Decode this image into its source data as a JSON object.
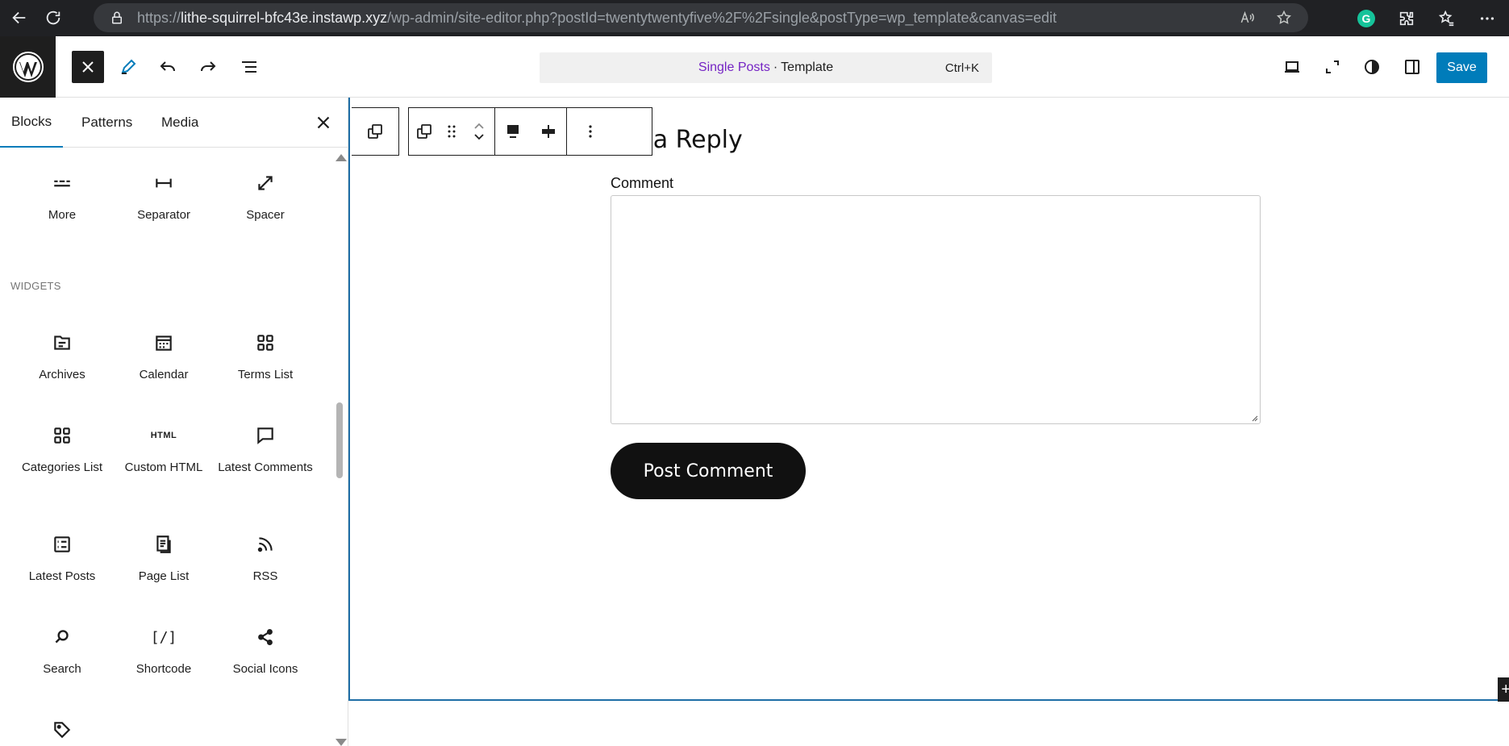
{
  "browser": {
    "url_prefix": "https://",
    "url_host": "lithe-squirrel-bfc43e.instawp.xyz",
    "url_path": "/wp-admin/site-editor.php?postId=twentytwentyfive%2F%2Fsingle&postType=wp_template&canvas=edit"
  },
  "header": {
    "doc_title": "Single Posts",
    "doc_sep": "·",
    "doc_type": "Template",
    "shortcut": "Ctrl+K",
    "save_label": "Save"
  },
  "inserter": {
    "tabs": [
      {
        "label": "Blocks"
      },
      {
        "label": "Patterns"
      },
      {
        "label": "Media"
      }
    ],
    "design_blocks": [
      {
        "label": "More",
        "icon": "more-icon"
      },
      {
        "label": "Separator",
        "icon": "separator-icon"
      },
      {
        "label": "Spacer",
        "icon": "spacer-icon"
      }
    ],
    "widgets_title": "WIDGETS",
    "widget_blocks": [
      {
        "label": "Archives",
        "icon": "archives-icon"
      },
      {
        "label": "Calendar",
        "icon": "calendar-icon"
      },
      {
        "label": "Terms List",
        "icon": "terms-list-icon"
      },
      {
        "label": "Categories List",
        "icon": "categories-list-icon"
      },
      {
        "label": "Custom HTML",
        "icon": "custom-html-icon",
        "glyph": "HTML"
      },
      {
        "label": "Latest Comments",
        "icon": "latest-comments-icon"
      },
      {
        "label": "Latest Posts",
        "icon": "latest-posts-icon"
      },
      {
        "label": "Page List",
        "icon": "page-list-icon"
      },
      {
        "label": "RSS",
        "icon": "rss-icon"
      },
      {
        "label": "Search",
        "icon": "search-icon"
      },
      {
        "label": "Shortcode",
        "icon": "shortcode-icon",
        "glyph": "[/]"
      },
      {
        "label": "Social Icons",
        "icon": "social-icons-icon"
      }
    ]
  },
  "canvas": {
    "reply_title": "ve a Reply",
    "comment_label": "Comment",
    "post_comment_label": "Post Comment"
  },
  "colors": {
    "accent": "#007cba",
    "doc_title": "#7524c4",
    "frame_border": "#1e6ea6"
  }
}
